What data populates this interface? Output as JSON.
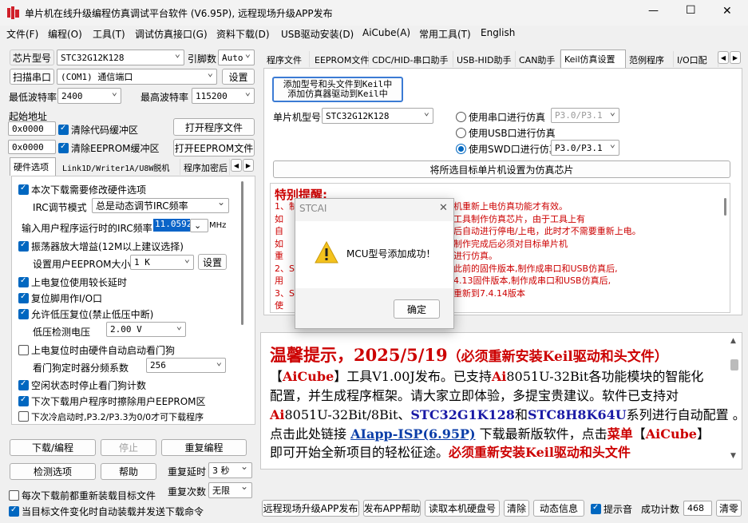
{
  "window": {
    "title": "单片机在线升级编程仿真调试平台软件 (V6.95P), 远程现场升级APP发布",
    "min": "—",
    "max": "☐",
    "close": "✕"
  },
  "menu": [
    "文件(F)",
    "编程(O)",
    "工具(T)",
    "调试仿真接口(G)",
    "资料下载(D)",
    "USB驱动安装(D)",
    "AiCube(A)",
    "常用工具(T)",
    "English"
  ],
  "left": {
    "chip_label": "芯片型号",
    "chip_value": "STC32G12K128",
    "pins_label": "引脚数",
    "pins_value": "Auto",
    "scan_btn": "扫描串口",
    "port_value": "(COM1) 通信端口",
    "settings_btn": "设置",
    "min_baud_label": "最低波特率",
    "min_baud_value": "2400",
    "max_baud_label": "最高波特率",
    "max_baud_value": "115200",
    "start_addr_label": "起始地址",
    "addr1": "0x0000",
    "clear_code": "清除代码缓冲区",
    "open_prog": "打开程序文件",
    "addr2": "0x0000",
    "clear_eeprom": "清除EEPROM缓冲区",
    "open_eeprom": "打开EEPROM文件",
    "tabs": [
      "硬件选项",
      "Link1D/Writer1A/U8W脱机",
      "程序加密后"
    ],
    "hw": {
      "modify": "本次下载需要修改硬件选项",
      "irc_mode_label": "IRC调节模式",
      "irc_mode_value": "总是动态调节IRC频率",
      "irc_freq_label": "输入用户程序运行时的IRC频率",
      "irc_freq_value": "11.0592",
      "irc_unit": "MHz",
      "osc_gain": "振荡器放大增益(12M以上建议选择)",
      "eeprom_size_label": "设置用户EEPROM大小",
      "eeprom_size_value": "1   K",
      "eeprom_set_btn": "设置",
      "long_reset": "上电复位使用较长延时",
      "reset_io": "复位脚用作I/O口",
      "low_volt_reset": "允许低压复位(禁止低压中断)",
      "low_volt_label": "低压检测电压",
      "low_volt_value": "2.00 V",
      "wdt_auto": "上电复位时由硬件自动启动看门狗",
      "wdt_div_label": "看门狗定时器分频系数",
      "wdt_div_value": "256",
      "idle_stop": "空闲状态时停止看门狗计数",
      "erase_eeprom": "下次下载用户程序时擦除用户EEPROM区",
      "cold_start": "下次冷启动时,P3.2/P3.3为0/0才可下载程序"
    },
    "download_btn": "下载/编程",
    "stop_btn": "停止",
    "reprog_btn": "重复编程",
    "detect_btn": "检测选项",
    "help_btn": "帮助",
    "repeat_delay_label": "重复延时",
    "repeat_delay_value": "3 秒",
    "repeat_count_label": "重复次数",
    "repeat_count_value": "无限",
    "reload_each": "每次下载前都重新装载目标文件",
    "auto_reload": "当目标文件变化时自动装载并发送下载命令"
  },
  "right": {
    "tabs": [
      "程序文件",
      "EEPROM文件",
      "CDC/HID-串口助手",
      "USB-HID助手",
      "CAN助手",
      "Keil仿真设置",
      "范例程序",
      "I/O口配"
    ],
    "active_tab": 5,
    "add_keil_line1": "添加型号和头文件到Keil中",
    "add_keil_line2": "添加仿真器驱动到Keil中",
    "mcu_label": "单片机型号",
    "mcu_value": "STC32G12K128",
    "radio_serial": "使用串口进行仿真",
    "serial_port_value": "P3.0/P3.1",
    "radio_usb": "使用USB口进行仿真",
    "radio_swd": "使用SWD口进行仿真",
    "swd_port_value": "P3.0/P3.1",
    "set_target_btn": "将所选目标单片机设置为仿真芯片",
    "notice_title": "特别提醒:",
    "notice_lines": [
      "1、制",
      "    如",
      "    自",
      "    如",
      "    重",
      "2、ST",
      "    用",
      "3、ST",
      "    使"
    ],
    "notice_right": [
      "机重新上电仿真功能才有效。",
      "工具制作仿真芯片，由于工具上有",
      "后自动进行停电/上电，此时才不需要重新上电。",
      "制作完成后必须对目标单片机",
      "进行仿真。",
      "此前的固件版本,制作成串口和USB仿真后,",
      "",
      "4.13固件版本,制作成串口和USB仿真后,",
      "重新到7.4.14版本"
    ]
  },
  "tips": {
    "heading_main": "温馨提示，2025/5/19",
    "heading_paren": "（必须重新安装Keil驱动和头文件）",
    "l1_a": "【",
    "l1_ai": "AiCube",
    "l1_b": "】工具V1.00J发布。已支持",
    "l1_ai2": "Ai",
    "l1_c": "8051U-32Bit各功能模块的智能化",
    "l2": "配置，并生成程序框架。请大家立即体验，多提宝贵建议。软件已支持对",
    "l3_ai": "Ai",
    "l3_a": "8051U-32Bit/8Bit、",
    "l3_stc32": "STC32G1K128",
    "l3_b": "和",
    "l3_stc8": "STC8H8K64U",
    "l3_c": "系列进行自动配置 。",
    "l4_a": "点击此处链接 ",
    "l4_link": "AIapp-ISP(6.95P)",
    "l4_b": " 下载最新版软件，点击",
    "l4_menu": "菜单",
    "l4_c": "【",
    "l4_ai": "AiCube",
    "l4_d": "】",
    "l5_a": "即可开始全新项目的轻松征途。",
    "l5_b": "必须重新安装Keil驱动和头文件"
  },
  "bottom": {
    "remote_btn": "远程现场升级APP发布",
    "app_help_btn": "发布APP帮助",
    "read_disk_btn": "读取本机硬盘号",
    "clear_btn": "清除",
    "anim_btn": "动态信息",
    "beep": "提示音",
    "success_label": "成功计数",
    "success_value": "468",
    "clear_count_btn": "清零"
  },
  "dialog": {
    "title": "STCAI",
    "close": "✕",
    "message": "MCU型号添加成功！",
    "ok": "确定"
  },
  "colors": {
    "accent": "#0067c0",
    "red": "#cc0000",
    "blue": "#1a1aa6",
    "link": "#0b3ea8",
    "titlebar": "#f3f3f3"
  }
}
